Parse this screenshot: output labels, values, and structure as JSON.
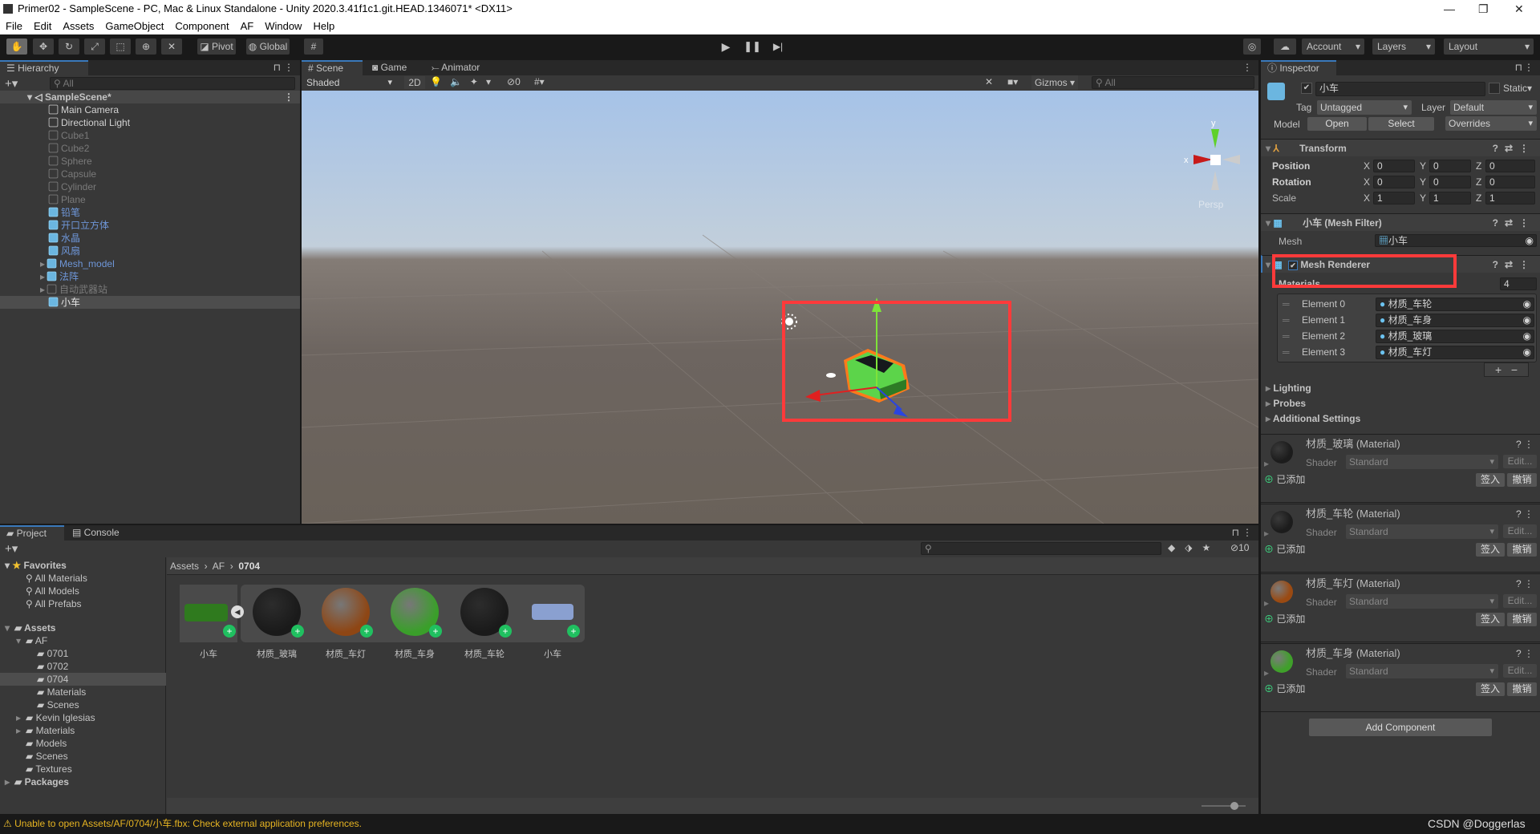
{
  "window": {
    "title": "Primer02 - SampleScene - PC, Mac & Linux Standalone - Unity 2020.3.41f1c1.git.HEAD.1346071* <DX11>"
  },
  "menu": [
    "File",
    "Edit",
    "Assets",
    "GameObject",
    "Component",
    "AF",
    "Window",
    "Help"
  ],
  "toolbar": {
    "pivot": "Pivot",
    "global": "Global",
    "account": "Account",
    "layers": "Layers",
    "layout": "Layout"
  },
  "hierarchy": {
    "tab": "Hierarchy",
    "search_placeholder": "All",
    "scene": "SampleScene*",
    "items": [
      {
        "label": "Main Camera",
        "kind": "object",
        "state": "active"
      },
      {
        "label": "Directional Light",
        "kind": "object",
        "state": "active"
      },
      {
        "label": "Cube1",
        "kind": "object",
        "state": "inactive"
      },
      {
        "label": "Cube2",
        "kind": "object",
        "state": "inactive"
      },
      {
        "label": "Sphere",
        "kind": "object",
        "state": "inactive"
      },
      {
        "label": "Capsule",
        "kind": "object",
        "state": "inactive"
      },
      {
        "label": "Cylinder",
        "kind": "object",
        "state": "inactive"
      },
      {
        "label": "Plane",
        "kind": "object",
        "state": "inactive"
      },
      {
        "label": "铅笔",
        "kind": "prefab",
        "state": "prefab"
      },
      {
        "label": "开口立方体",
        "kind": "prefab",
        "state": "prefab"
      },
      {
        "label": "水晶",
        "kind": "prefab",
        "state": "prefab"
      },
      {
        "label": "风扇",
        "kind": "prefab",
        "state": "prefab"
      },
      {
        "label": "Mesh_model",
        "kind": "prefab",
        "state": "prefab",
        "expandable": true
      },
      {
        "label": "法阵",
        "kind": "prefab",
        "state": "prefab",
        "expandable": true
      },
      {
        "label": "自动武器站",
        "kind": "object",
        "state": "inactive",
        "expandable": true
      },
      {
        "label": "小车",
        "kind": "prefab",
        "state": "selected"
      }
    ]
  },
  "scene": {
    "tabs": [
      "Scene",
      "Game",
      "Animator"
    ],
    "shading": "Shaded",
    "mode_2d": "2D",
    "hidden_count": "0",
    "gizmos": "Gizmos",
    "search_placeholder": "All",
    "orientation": {
      "x": "x",
      "y": "y",
      "projection": "Persp"
    }
  },
  "inspector": {
    "tab": "Inspector",
    "name": "小车",
    "active": true,
    "static_label": "Static",
    "tag_label": "Tag",
    "tag": "Untagged",
    "layer_label": "Layer",
    "layer": "Default",
    "model_label": "Model",
    "open": "Open",
    "select": "Select",
    "overrides": "Overrides",
    "transform": {
      "title": "Transform",
      "rows": [
        {
          "label": "Position",
          "x": "0",
          "y": "0",
          "z": "0"
        },
        {
          "label": "Rotation",
          "x": "0",
          "y": "0",
          "z": "0"
        },
        {
          "label": "Scale",
          "x": "1",
          "y": "1",
          "z": "1"
        }
      ]
    },
    "mesh_filter": {
      "title": "小车 (Mesh Filter)",
      "mesh_label": "Mesh",
      "mesh": "小车"
    },
    "mesh_renderer": {
      "title": "Mesh Renderer",
      "enabled": true,
      "materials_label": "Materials",
      "materials_count": "4",
      "elements": [
        {
          "label": "Element 0",
          "value": "材质_车轮"
        },
        {
          "label": "Element 1",
          "value": "材质_车身"
        },
        {
          "label": "Element 2",
          "value": "材质_玻璃"
        },
        {
          "label": "Element 3",
          "value": "材质_车灯"
        }
      ],
      "sections": [
        "Lighting",
        "Probes",
        "Additional Settings"
      ]
    },
    "materials": [
      {
        "title": "材质_玻璃 (Material)",
        "color": "#1c1c1c"
      },
      {
        "title": "材质_车轮 (Material)",
        "color": "#1c1c1c"
      },
      {
        "title": "材质_车灯 (Material)",
        "color": "#9a4a12"
      },
      {
        "title": "材质_车身 (Material)",
        "color": "#3fa02a"
      }
    ],
    "shader_label": "Shader",
    "shader": "Standard",
    "edit": "Edit...",
    "vcs_status": "已添加",
    "checkin": "签入",
    "revert": "撤销",
    "add_component": "Add Component"
  },
  "project": {
    "tabs": [
      "Project",
      "Console"
    ],
    "hidden_count": "10",
    "favorites": {
      "label": "Favorites",
      "items": [
        "All Materials",
        "All Models",
        "All Prefabs"
      ]
    },
    "tree": [
      {
        "label": "Assets",
        "depth": 0,
        "open": true
      },
      {
        "label": "AF",
        "depth": 1,
        "open": true
      },
      {
        "label": "0701",
        "depth": 2
      },
      {
        "label": "0702",
        "depth": 2
      },
      {
        "label": "0704",
        "depth": 2,
        "selected": true
      },
      {
        "label": "Materials",
        "depth": 2
      },
      {
        "label": "Scenes",
        "depth": 2
      },
      {
        "label": "Kevin Iglesias",
        "depth": 1,
        "collapsed": true
      },
      {
        "label": "Materials",
        "depth": 1,
        "collapsed": true
      },
      {
        "label": "Models",
        "depth": 1
      },
      {
        "label": "Scenes",
        "depth": 1
      },
      {
        "label": "Textures",
        "depth": 1
      },
      {
        "label": "Packages",
        "depth": 0,
        "collapsed": true
      }
    ],
    "breadcrumb": [
      "Assets",
      "AF",
      "0704"
    ],
    "assets": [
      {
        "label": "小车",
        "type": "model"
      },
      {
        "label": "材质_玻璃",
        "type": "material",
        "color": "#1a1a1a"
      },
      {
        "label": "材质_车灯",
        "type": "material",
        "color": "#8e4614"
      },
      {
        "label": "材质_车身",
        "type": "material",
        "color": "#3a9f2a"
      },
      {
        "label": "材质_车轮",
        "type": "material",
        "color": "#1a1a1a"
      },
      {
        "label": "小车",
        "type": "mesh"
      }
    ]
  },
  "status": {
    "message": "Unable to open Assets/AF/0704/小车.fbx: Check external application preferences.",
    "color": "#e6b422"
  },
  "watermark": "CSDN @Doggerlas"
}
